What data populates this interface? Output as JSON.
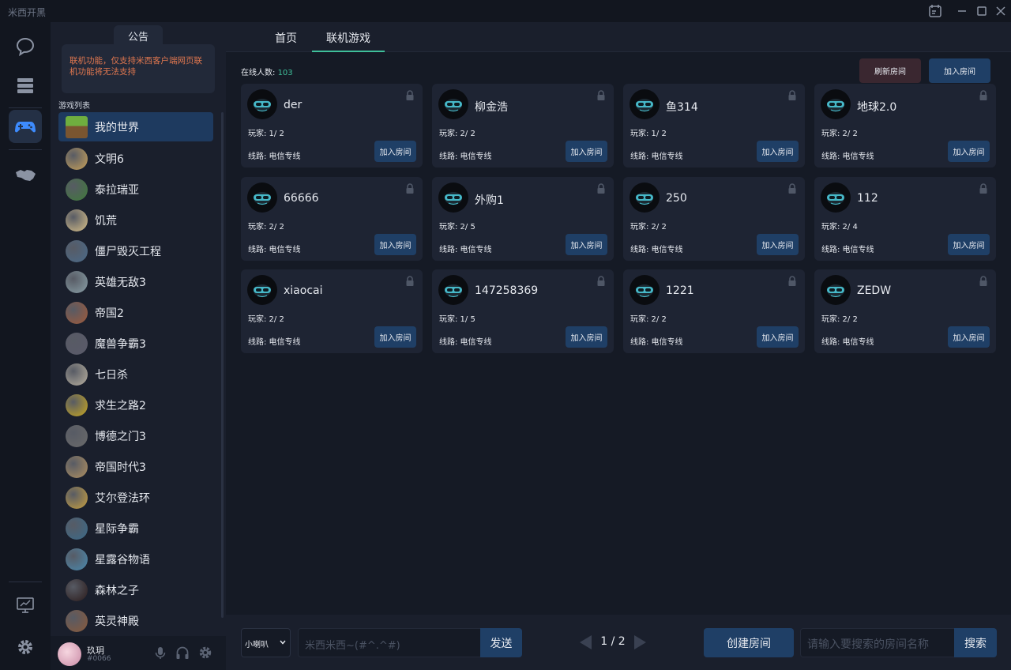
{
  "app": {
    "title": "米西开黑"
  },
  "notice": {
    "tab_label": "公告",
    "text": "联机功能，仅支持米西客户端网页联机功能将无法支持"
  },
  "sidebar": {
    "section_label": "游戏列表",
    "games": [
      {
        "name": "我的世界",
        "color": "#5c8a3a",
        "active": true
      },
      {
        "name": "文明6",
        "color": "#c9a25a"
      },
      {
        "name": "泰拉瑞亚",
        "color": "#3f7a3a"
      },
      {
        "name": "饥荒",
        "color": "#d8c08a"
      },
      {
        "name": "僵尸毁灭工程",
        "color": "#4a6a8a"
      },
      {
        "name": "英雄无敌3",
        "color": "#8aa0a8"
      },
      {
        "name": "帝国2",
        "color": "#a05a3a"
      },
      {
        "name": "魔兽争霸3",
        "color": "#5a5a6a"
      },
      {
        "name": "七日杀",
        "color": "#b8b0a0"
      },
      {
        "name": "求生之路2",
        "color": "#c8a820"
      },
      {
        "name": "博德之门3",
        "color": "#6a6a6a"
      },
      {
        "name": "帝国时代3",
        "color": "#b09060"
      },
      {
        "name": "艾尔登法环",
        "color": "#c8a040"
      },
      {
        "name": "星际争霸",
        "color": "#3a6a8a"
      },
      {
        "name": "星露谷物语",
        "color": "#4a8ab0"
      },
      {
        "name": "森林之子",
        "color": "#2a1a1a"
      },
      {
        "name": "英灵神殿",
        "color": "#8a5a3a"
      }
    ]
  },
  "user": {
    "name": "玖玥",
    "id": "#0066"
  },
  "tabs": [
    {
      "label": "首页"
    },
    {
      "label": "联机游戏"
    }
  ],
  "content": {
    "online_label": "在线人数:",
    "online_count": "103",
    "refresh_label": "刷新房间",
    "join_label": "加入房间"
  },
  "rooms": [
    {
      "name": "der",
      "players": "玩家:  1/ 2",
      "line": "线路: 电信专线",
      "join": "加入房间"
    },
    {
      "name": "柳金浩",
      "players": "玩家:  2/ 2",
      "line": "线路: 电信专线",
      "join": "加入房间"
    },
    {
      "name": "鱼314",
      "players": "玩家:  1/ 2",
      "line": "线路: 电信专线",
      "join": "加入房间"
    },
    {
      "name": "地球2.0",
      "players": "玩家:  2/ 2",
      "line": "线路: 电信专线",
      "join": "加入房间"
    },
    {
      "name": "66666",
      "players": "玩家:  2/ 2",
      "line": "线路: 电信专线",
      "join": "加入房间"
    },
    {
      "name": "外购1",
      "players": "玩家:  2/ 5",
      "line": "线路: 电信专线",
      "join": "加入房间"
    },
    {
      "name": "250",
      "players": "玩家:  2/ 2",
      "line": "线路: 电信专线",
      "join": "加入房间"
    },
    {
      "name": "112",
      "players": "玩家:  2/ 4",
      "line": "线路: 电信专线",
      "join": "加入房间"
    },
    {
      "name": "xiaocai",
      "players": "玩家:  2/ 2",
      "line": "线路: 电信专线",
      "join": "加入房间"
    },
    {
      "name": "147258369",
      "players": "玩家:  1/ 5",
      "line": "线路: 电信专线",
      "join": "加入房间"
    },
    {
      "name": "1221",
      "players": "玩家:  2/ 2",
      "line": "线路: 电信专线",
      "join": "加入房间"
    },
    {
      "name": "ZEDW",
      "players": "玩家:  2/ 2",
      "line": "线路: 电信专线",
      "join": "加入房间"
    }
  ],
  "footer": {
    "channel_select": "小喇叭",
    "chat_placeholder": "米西米西~(#^.^#)",
    "send_label": "发送",
    "page": "1 / 2",
    "create_label": "创建房间",
    "search_placeholder": "请输入要搜索的房间名称",
    "search_label": "搜索"
  }
}
